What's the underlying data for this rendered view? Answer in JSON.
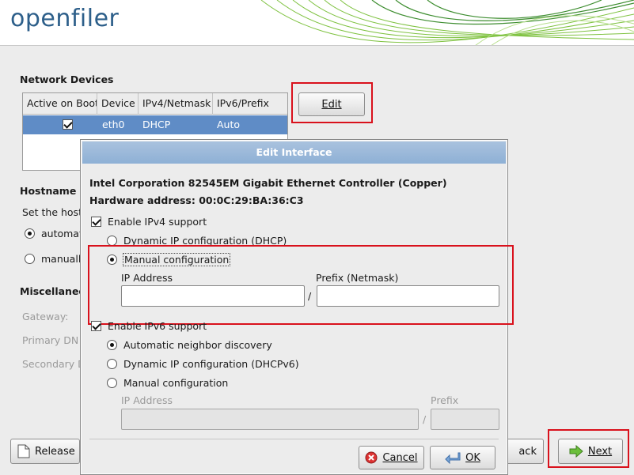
{
  "header": {
    "logo_text": "openfiler",
    "brand_color": "#2d5f8a",
    "accent_color": "#7fc241"
  },
  "main": {
    "network_devices_title": "Network Devices",
    "table": {
      "columns": [
        "Active on Boot",
        "Device",
        "IPv4/Netmask",
        "IPv6/Prefix"
      ],
      "rows": [
        {
          "active": true,
          "device": "eth0",
          "ipv4": "DHCP",
          "ipv6": "Auto"
        }
      ]
    },
    "edit_button": "Edit",
    "hostname_title": "Hostname",
    "hostname_desc": "Set the host",
    "hostname_auto": "automat",
    "hostname_manual": "manually",
    "misc_title": "Miscellanec",
    "gateway_label": "Gateway:",
    "primary_dns_label": "Primary DN",
    "secondary_dns_label": "Secondary D",
    "release_button": "Release",
    "back_button": "ack",
    "next_button": "Next"
  },
  "dialog": {
    "title": "Edit Interface",
    "device_name": "Intel Corporation 82545EM Gigabit Ethernet Controller (Copper)",
    "hardware_address": "Hardware address: 00:0C:29:BA:36:C3",
    "ipv4": {
      "enable_label": "Enable IPv4 support",
      "enabled": true,
      "dhcp_label": "Dynamic IP configuration (DHCP)",
      "manual_label": "Manual configuration",
      "selected": "manual",
      "ip_label": "IP Address",
      "prefix_label": "Prefix (Netmask)",
      "ip_value": "",
      "prefix_value": "",
      "separator": "/"
    },
    "ipv6": {
      "enable_label": "Enable IPv6 support",
      "enabled": true,
      "auto_label": "Automatic neighbor discovery",
      "dhcp_label": "Dynamic IP configuration (DHCPv6)",
      "manual_label": "Manual configuration",
      "selected": "auto",
      "ip_label": "IP Address",
      "prefix_label": "Prefix",
      "separator": "/"
    },
    "cancel_button": "Cancel",
    "ok_button": "OK"
  }
}
